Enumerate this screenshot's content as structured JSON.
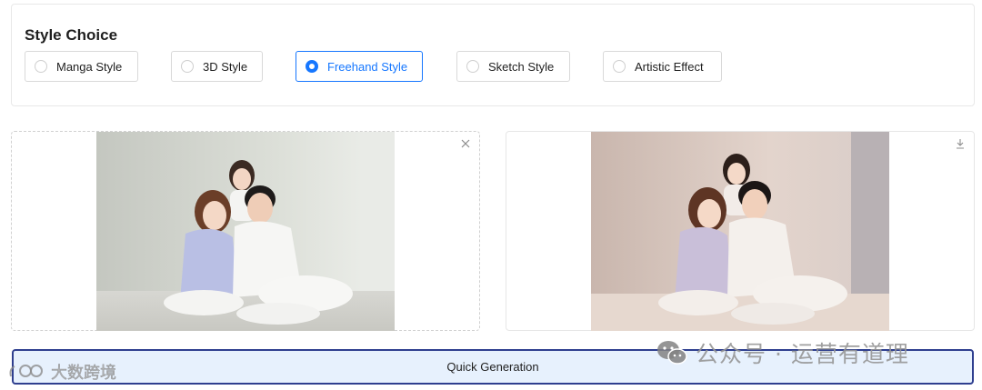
{
  "style_choice": {
    "title": "Style Choice",
    "options": [
      {
        "label": "Manga Style",
        "selected": false
      },
      {
        "label": "3D Style",
        "selected": false
      },
      {
        "label": "Freehand Style",
        "selected": true
      },
      {
        "label": "Sketch Style",
        "selected": false
      },
      {
        "label": "Artistic Effect",
        "selected": false
      }
    ]
  },
  "input_panel": {
    "image_alt": "family-photo",
    "close_icon": "close-icon"
  },
  "output_panel": {
    "image_alt": "freehand-style-family-illustration",
    "download_icon": "download-icon"
  },
  "generate": {
    "label": "Quick Generation"
  },
  "watermarks": {
    "left_text": "大数跨境",
    "right_text": "公众号 · 运营有道理"
  },
  "colors": {
    "accent": "#1677ff",
    "button_bg": "#e7f1fd",
    "button_border": "#2f3f8f"
  }
}
